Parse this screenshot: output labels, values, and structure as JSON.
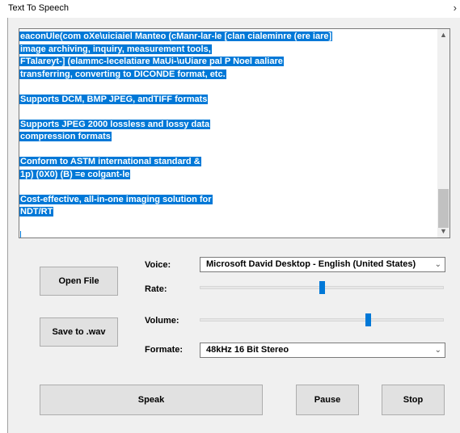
{
  "window": {
    "title": "Text To Speech",
    "chevron_glyph": "›"
  },
  "text_area": {
    "lines": [
      "eaconUle(com oXe\\uiciaiel Manteo (cManr-lar-le [clan cialeminre (ere iare]",
      "image archiving, inquiry, measurement tools,",
      "FTalareyt-] (elammc-lecelatiare MaUi-\\uUiare pal P Noel aaliare",
      "transferring, converting to DICONDE format, etc.",
      "",
      "Supports DCM, BMP JPEG, andTIFF formats",
      "",
      "Supports JPEG 2000 lossless and lossy data",
      "compression formats",
      "",
      "Conform to ASTM international standard &",
      "1p) (0X0) (B) =e colgant-le",
      "",
      "Cost-effective, all-in-one imaging solution for",
      "NDT/RT",
      ""
    ],
    "scroll_up_glyph": "▲",
    "scroll_down_glyph": "▼"
  },
  "buttons": {
    "open_file": "Open File",
    "save_wav": "Save to .wav",
    "speak": "Speak",
    "pause": "Pause",
    "stop": "Stop"
  },
  "labels": {
    "voice": "Voice:",
    "rate": "Rate:",
    "volume": "Volume:",
    "format": "Formate:"
  },
  "voice_select": {
    "value": "Microsoft David Desktop - English (United States)",
    "arrow": "⌄"
  },
  "format_select": {
    "value": "48kHz 16 Bit Stereo",
    "arrow": "⌄"
  },
  "rate_slider": {
    "value_fraction": 0.5
  },
  "volume_slider": {
    "value_fraction": 0.69
  }
}
